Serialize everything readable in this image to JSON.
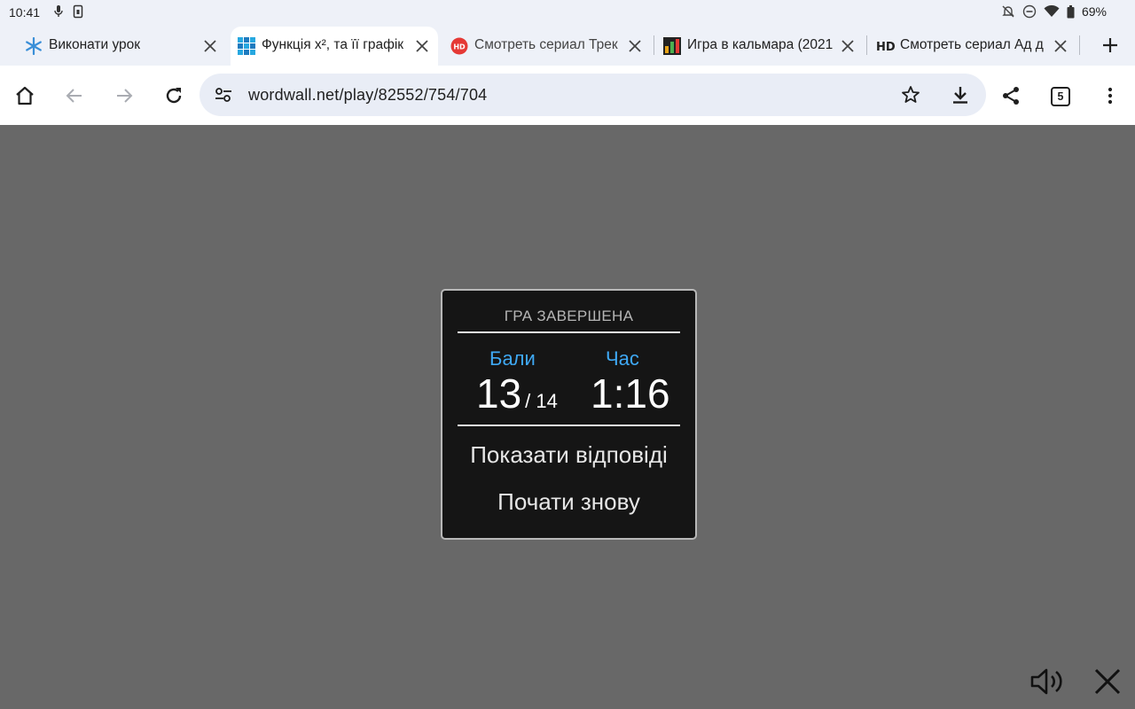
{
  "status_bar": {
    "time": "10:41",
    "battery": "69%"
  },
  "tabs": [
    {
      "title": "Виконати урок",
      "favicon": "snowflake-icon",
      "active": false
    },
    {
      "title": "Функція x², та її графік",
      "favicon": "grid-icon",
      "active": true
    },
    {
      "title": "Смотреть сериал Трек",
      "favicon": "hd-badge-icon",
      "active": false
    },
    {
      "title": "Игра в кальмара (2021",
      "favicon": "bar-chart-icon",
      "active": false
    },
    {
      "title": "Смотреть сериал Ад д",
      "favicon": "hd-text-icon",
      "active": false
    }
  ],
  "toolbar": {
    "url": "wordwall.net/play/82552/754/704",
    "tab_count": "5"
  },
  "game_over": {
    "heading": "ГРА ЗАВЕРШЕНА",
    "score_label": "Бали",
    "score": "13",
    "score_total": "/ 14",
    "time_label": "Час",
    "time": "1:16",
    "show_answers": "Показати відповіді",
    "restart": "Почати знову"
  },
  "colors": {
    "accent": "#3fa9f5",
    "backdrop": "#686868",
    "dialog_bg": "#151515"
  }
}
